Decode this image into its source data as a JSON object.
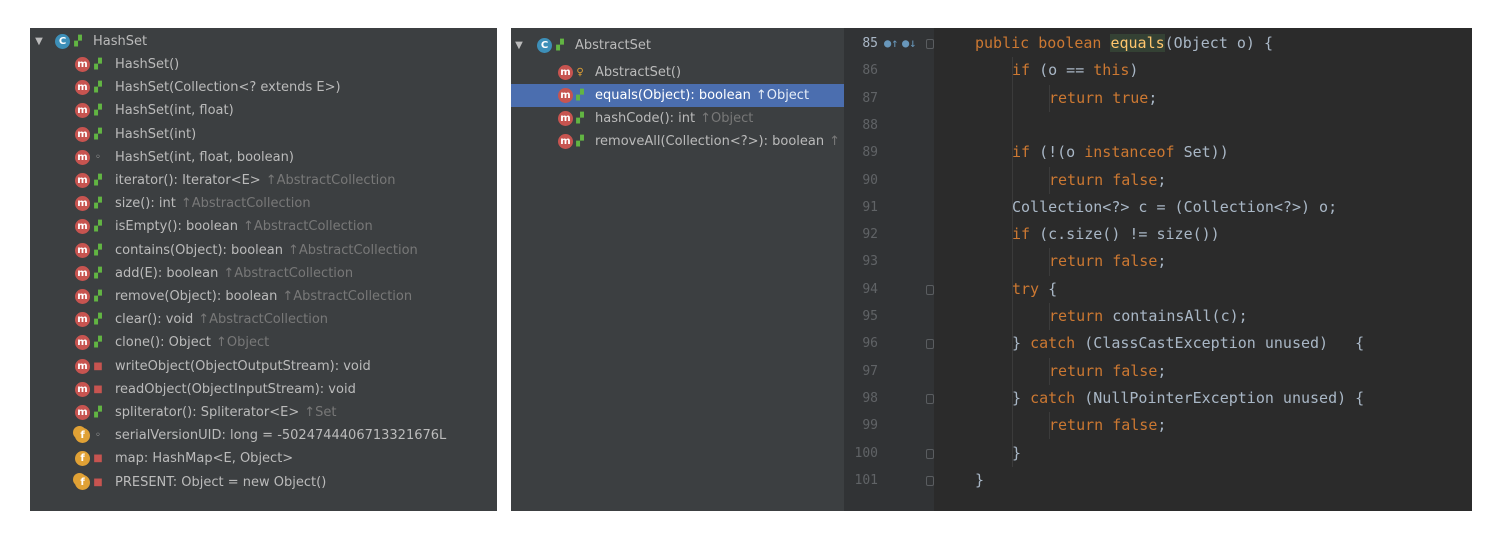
{
  "left_tree": {
    "root": {
      "label": "HashSet",
      "icon": "class-icon"
    },
    "items": [
      {
        "badge": "m",
        "vis": "public",
        "label": "HashSet()",
        "inherit": ""
      },
      {
        "badge": "m",
        "vis": "public",
        "label": "HashSet(Collection<? extends E>)",
        "inherit": ""
      },
      {
        "badge": "m",
        "vis": "public",
        "label": "HashSet(int, float)",
        "inherit": ""
      },
      {
        "badge": "m",
        "vis": "public",
        "label": "HashSet(int)",
        "inherit": ""
      },
      {
        "badge": "m",
        "vis": "package",
        "label": "HashSet(int, float, boolean)",
        "inherit": ""
      },
      {
        "badge": "m",
        "vis": "public",
        "label": "iterator(): Iterator<E>",
        "inherit": "↑AbstractCollection"
      },
      {
        "badge": "m",
        "vis": "public",
        "label": "size(): int",
        "inherit": "↑AbstractCollection"
      },
      {
        "badge": "m",
        "vis": "public",
        "label": "isEmpty(): boolean",
        "inherit": "↑AbstractCollection"
      },
      {
        "badge": "m",
        "vis": "public",
        "label": "contains(Object): boolean",
        "inherit": "↑AbstractCollection"
      },
      {
        "badge": "m",
        "vis": "public",
        "label": "add(E): boolean",
        "inherit": "↑AbstractCollection"
      },
      {
        "badge": "m",
        "vis": "public",
        "label": "remove(Object): boolean",
        "inherit": "↑AbstractCollection"
      },
      {
        "badge": "m",
        "vis": "public",
        "label": "clear(): void",
        "inherit": "↑AbstractCollection"
      },
      {
        "badge": "m",
        "vis": "public",
        "label": "clone(): Object",
        "inherit": "↑Object"
      },
      {
        "badge": "m",
        "vis": "private",
        "label": "writeObject(ObjectOutputStream): void",
        "inherit": ""
      },
      {
        "badge": "m",
        "vis": "private",
        "label": "readObject(ObjectInputStream): void",
        "inherit": ""
      },
      {
        "badge": "m",
        "vis": "public",
        "label": "spliterator(): Spliterator<E>",
        "inherit": "↑Set"
      },
      {
        "badge": "fs",
        "vis": "package",
        "label": "serialVersionUID: long = -5024744406713321676L",
        "inherit": ""
      },
      {
        "badge": "f",
        "vis": "private",
        "label": "map: HashMap<E, Object>",
        "inherit": ""
      },
      {
        "badge": "fs",
        "vis": "private",
        "label": "PRESENT: Object = new Object()",
        "inherit": ""
      }
    ]
  },
  "mid_tree": {
    "root": {
      "label": "AbstractSet",
      "icon": "abstract-class-icon"
    },
    "items": [
      {
        "badge": "m",
        "vis": "protected",
        "label": "AbstractSet()",
        "inherit": "",
        "selected": false
      },
      {
        "badge": "m",
        "vis": "public",
        "label": "equals(Object): boolean",
        "inherit": "↑Object",
        "selected": true
      },
      {
        "badge": "m",
        "vis": "public",
        "label": "hashCode(): int",
        "inherit": "↑Object",
        "selected": false
      },
      {
        "badge": "m",
        "vis": "public",
        "label": "removeAll(Collection<?>): boolean",
        "inherit": "↑",
        "selected": false
      }
    ]
  },
  "editor": {
    "lines": [
      {
        "n": "85",
        "indent": 0,
        "tokens": [
          [
            "kw",
            "public boolean "
          ],
          [
            "fn",
            "equals"
          ],
          [
            "",
            "(Object o) {"
          ]
        ]
      },
      {
        "n": "86",
        "indent": 1,
        "tokens": [
          [
            "kw",
            "if "
          ],
          [
            "",
            "(o == "
          ],
          [
            "kw",
            "this"
          ],
          [
            "",
            ")"
          ]
        ]
      },
      {
        "n": "87",
        "indent": 2,
        "tokens": [
          [
            "kw",
            "return true"
          ],
          [
            "",
            ";"
          ]
        ]
      },
      {
        "n": "88",
        "indent": 0,
        "tokens": []
      },
      {
        "n": "89",
        "indent": 1,
        "tokens": [
          [
            "kw",
            "if "
          ],
          [
            "",
            "(!(o "
          ],
          [
            "kw",
            "instanceof "
          ],
          [
            "",
            "Set))"
          ]
        ]
      },
      {
        "n": "90",
        "indent": 2,
        "tokens": [
          [
            "kw",
            "return false"
          ],
          [
            "",
            ";"
          ]
        ]
      },
      {
        "n": "91",
        "indent": 1,
        "tokens": [
          [
            "",
            "Collection<?> c = (Collection<?>) o;"
          ]
        ]
      },
      {
        "n": "92",
        "indent": 1,
        "tokens": [
          [
            "kw",
            "if "
          ],
          [
            "",
            "(c.size() != size())"
          ]
        ]
      },
      {
        "n": "93",
        "indent": 2,
        "tokens": [
          [
            "kw",
            "return false"
          ],
          [
            "",
            ";"
          ]
        ]
      },
      {
        "n": "94",
        "indent": 1,
        "tokens": [
          [
            "kw",
            "try "
          ],
          [
            "",
            "{"
          ]
        ]
      },
      {
        "n": "95",
        "indent": 2,
        "tokens": [
          [
            "kw",
            "return "
          ],
          [
            "",
            "containsAll(c);"
          ]
        ]
      },
      {
        "n": "96",
        "indent": 1,
        "tokens": [
          [
            "",
            "} "
          ],
          [
            "kw",
            "catch "
          ],
          [
            "",
            "(ClassCastException unused)   {"
          ]
        ]
      },
      {
        "n": "97",
        "indent": 2,
        "tokens": [
          [
            "kw",
            "return false"
          ],
          [
            "",
            ";"
          ]
        ]
      },
      {
        "n": "98",
        "indent": 1,
        "tokens": [
          [
            "",
            "} "
          ],
          [
            "kw",
            "catch "
          ],
          [
            "",
            "(NullPointerException unused) {"
          ]
        ]
      },
      {
        "n": "99",
        "indent": 2,
        "tokens": [
          [
            "kw",
            "return false"
          ],
          [
            "",
            ";"
          ]
        ]
      },
      {
        "n": "100",
        "indent": 1,
        "tokens": [
          [
            "",
            "}"
          ]
        ]
      },
      {
        "n": "101",
        "indent": 0,
        "tokens": [
          [
            "",
            "}"
          ]
        ]
      }
    ],
    "fold_lines": [
      "85",
      "94",
      "96",
      "98",
      "100",
      "101"
    ]
  },
  "colors": {
    "panel_bg": "#3c3f41",
    "editor_bg": "#2b2b2b",
    "selection": "#4b6eaf",
    "keyword": "#cc7832",
    "method_decl": "#ffc66d",
    "text": "#a9b7c6"
  }
}
